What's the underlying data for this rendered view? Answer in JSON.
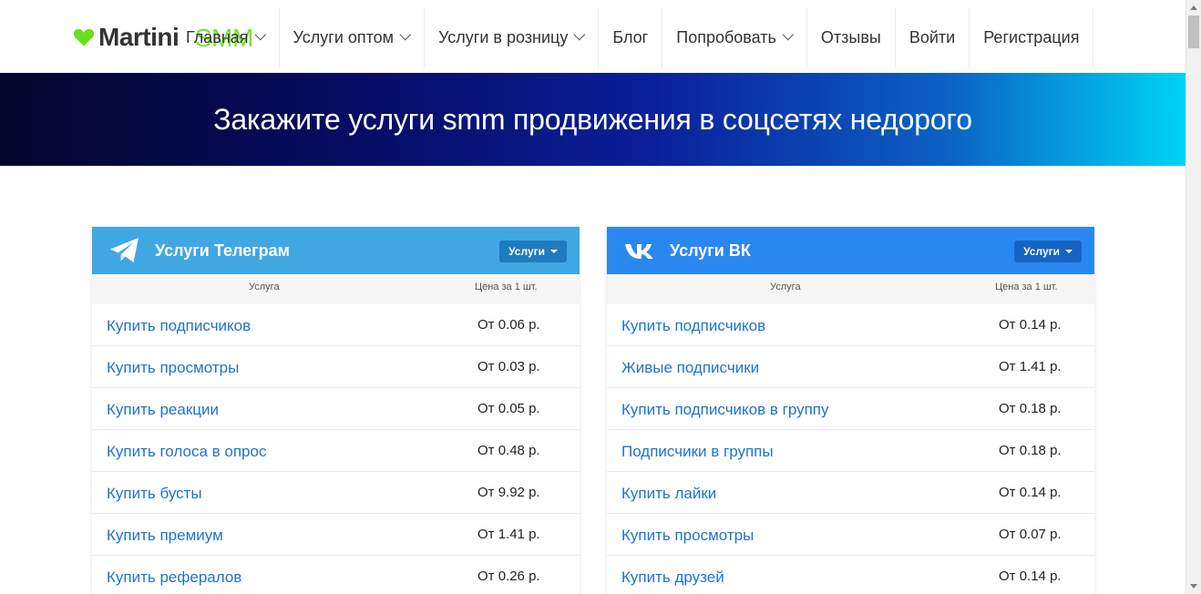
{
  "brand": {
    "name_part1": "Martini",
    "name_part2": "SMM",
    "heart_color": "#66e01c"
  },
  "nav": {
    "items": [
      {
        "label": "Главная",
        "has_dropdown": true
      },
      {
        "label": "Услуги оптом",
        "has_dropdown": true
      },
      {
        "label": "Услуги в розницу",
        "has_dropdown": true
      },
      {
        "label": "Блог",
        "has_dropdown": false
      },
      {
        "label": "Попробовать",
        "has_dropdown": true
      },
      {
        "label": "Отзывы",
        "has_dropdown": false
      },
      {
        "label": "Войти",
        "has_dropdown": false
      },
      {
        "label": "Регистрация",
        "has_dropdown": false
      }
    ]
  },
  "hero": {
    "title": "Закажите услуги smm продвижения в соцсетях недорого"
  },
  "telegram": {
    "title": "Услуги Телеграм",
    "button_label": "Услуги",
    "header_color": "#40a7e3",
    "col_service": "Услуга",
    "col_price": "Цена за 1 шт.",
    "rows": [
      {
        "service": "Купить подписчиков",
        "price": "От 0.06 р."
      },
      {
        "service": "Купить просмотры",
        "price": "От 0.03 р."
      },
      {
        "service": "Купить реакции",
        "price": "От 0.05 р."
      },
      {
        "service": "Купить голоса в опрос",
        "price": "От 0.48 р."
      },
      {
        "service": "Купить бусты",
        "price": "От 9.92 р."
      },
      {
        "service": "Купить премиум",
        "price": "От 1.41 р."
      },
      {
        "service": "Купить рефералов",
        "price": "От 0.26 р."
      }
    ]
  },
  "vk": {
    "title": "Услуги ВК",
    "button_label": "Услуги",
    "header_color": "#2b87f0",
    "col_service": "Услуга",
    "col_price": "Цена за 1 шт.",
    "rows": [
      {
        "service": "Купить подписчиков",
        "price": "От 0.14 р."
      },
      {
        "service": "Живые подписчики",
        "price": "От 1.41 р."
      },
      {
        "service": "Купить подписчиков в группу",
        "price": "От 0.18 р."
      },
      {
        "service": "Подписчики в группы",
        "price": "От 0.18 р."
      },
      {
        "service": "Купить лайки",
        "price": "От 0.14 р."
      },
      {
        "service": "Купить просмотры",
        "price": "От 0.07 р."
      },
      {
        "service": "Купить друзей",
        "price": "От 0.14 р."
      }
    ]
  },
  "link_color": "#1e73d1"
}
